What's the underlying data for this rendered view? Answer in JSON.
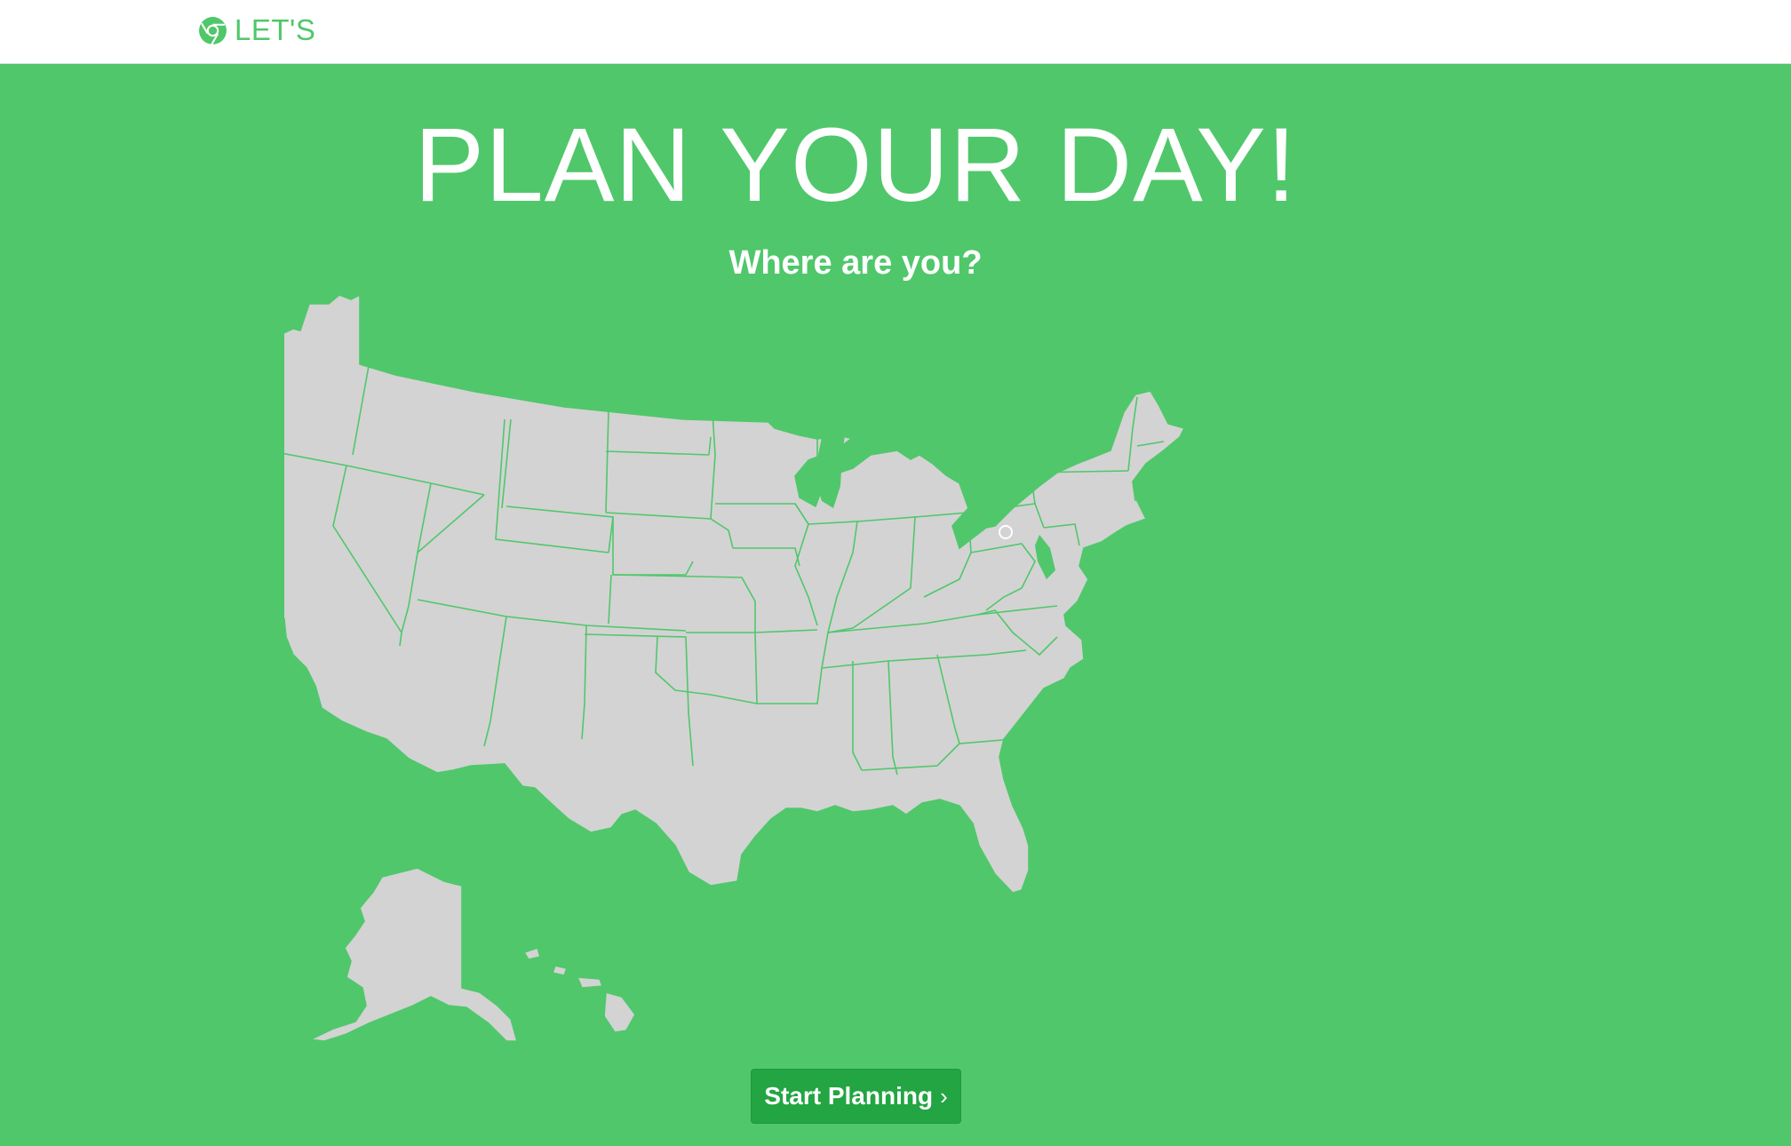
{
  "navbar": {
    "brand_label": "LET'S",
    "brand_icon": "chrome-icon"
  },
  "hero": {
    "title": "PLAN YOUR DAY!",
    "subtitle": "Where are you?"
  },
  "map": {
    "land_color": "#d3d3d3",
    "background_color": "#50c76b"
  },
  "action": {
    "start_label": "Start Planning",
    "start_icon": "chevron-right-icon",
    "button_color": "#22a542"
  }
}
